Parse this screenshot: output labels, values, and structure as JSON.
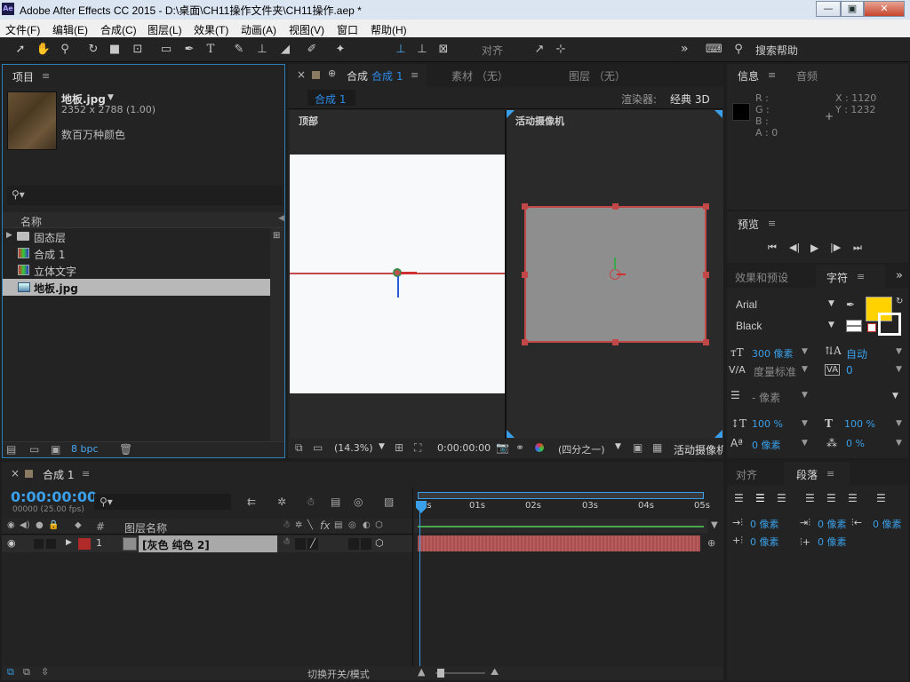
{
  "window": {
    "title": "Adobe After Effects CC 2015 - D:\\桌面\\CH11操作文件夹\\CH11操作.aep *",
    "app_icon": "Ae",
    "btn_min": "—",
    "btn_max": "▣",
    "btn_close": "✕"
  },
  "menu": [
    "文件(F)",
    "编辑(E)",
    "合成(C)",
    "图层(L)",
    "效果(T)",
    "动画(A)",
    "视图(V)",
    "窗口",
    "帮助(H)"
  ],
  "toolbar": {
    "align_label": "对齐",
    "search_help": "搜索帮助",
    "more": "»"
  },
  "project": {
    "tab": "项目",
    "menu_icon": "≡",
    "item_name": "地板.jpg",
    "item_name_arrow": "▼",
    "item_dims": "2352 x 2788 (1.00)",
    "item_color": "数百万种颜色",
    "search_placeholder": "",
    "col_name": "名称",
    "items": [
      {
        "label": "固态层",
        "type": "folder",
        "selected": false
      },
      {
        "label": "合成 1",
        "type": "comp",
        "selected": false
      },
      {
        "label": "立体文字",
        "type": "comp",
        "selected": false
      },
      {
        "label": "地板.jpg",
        "type": "image",
        "selected": true
      }
    ],
    "bpc": "8 bpc"
  },
  "comp": {
    "tab_close": "×",
    "tab_lock": "🔓",
    "tab_label": "合成",
    "tab_name": "合成 1",
    "menu_icon": "≡",
    "footage_tab": "素材 （无）",
    "layer_tab": "图层 （无）",
    "breadcrumb": "合成 1",
    "renderer_label": "渲染器:",
    "renderer_value": "经典 3D",
    "view_left": "顶部",
    "view_right": "活动摄像机",
    "zoom": "(14.3%)",
    "timecode": "0:00:00:00",
    "layout": "(四分之一)",
    "camera": "活动摄像机"
  },
  "info": {
    "tab": "信息",
    "menu_icon": "≡",
    "audio_tab": "音频",
    "r": "R :",
    "g": "G :",
    "b": "B :",
    "a": "A : 0",
    "x": "X : 1120",
    "y": "Y : 1232"
  },
  "preview": {
    "tab": "预览",
    "menu_icon": "≡"
  },
  "character": {
    "effects_tab": "效果和预设",
    "tab": "字符",
    "menu_icon": "≡",
    "more": "»",
    "font": "Arial",
    "style": "Black",
    "size": "300 像素",
    "leading": "自动",
    "kerning": "度量标准",
    "tracking": "0",
    "stroke": "- 像素",
    "vscale": "100 %",
    "hscale": "100 %",
    "baseline": "0 像素",
    "tsume": "0 %",
    "fill_color": "#ffd200"
  },
  "paragraph": {
    "align_tab": "对齐",
    "tab": "段落",
    "menu_icon": "≡",
    "indent_left": "0 像素",
    "indent_first": "0 像素",
    "indent_right": "0 像素",
    "space_before": "0 像素",
    "space_after": "0 像素"
  },
  "timeline": {
    "tab_close": "×",
    "tab": "合成 1",
    "menu_icon": "≡",
    "timecode": "0:00:00:00",
    "fps": "00000 (25.00 fps)",
    "col_num": "#",
    "col_name": "图层名称",
    "col_fx": "fx",
    "layer_index": "1",
    "layer_name": "[灰色 纯色 2]",
    "layer_color": "#b02a2a",
    "ruler": [
      "0s",
      "01s",
      "02s",
      "03s",
      "04s",
      "05s"
    ],
    "switch_mode": "切换开关/模式"
  }
}
